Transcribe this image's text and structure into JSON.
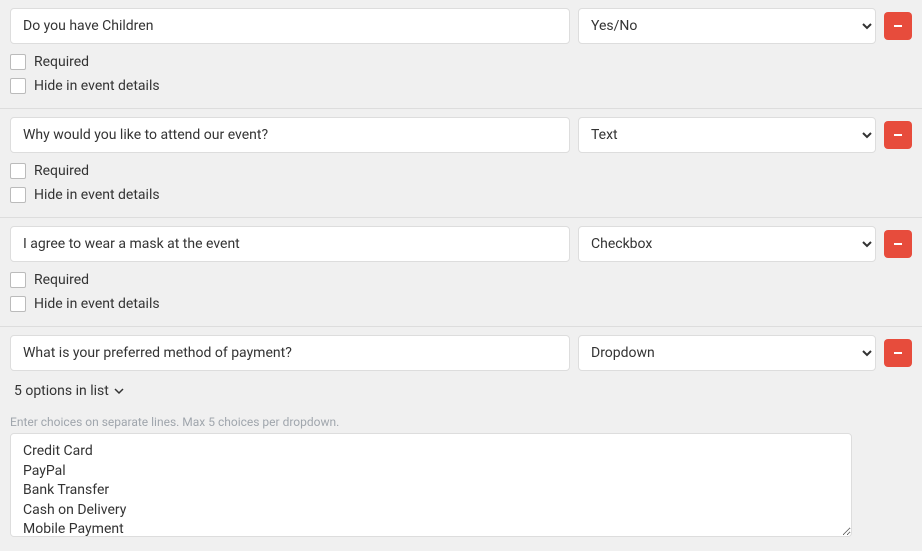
{
  "labels": {
    "required": "Required",
    "hide": "Hide in event details"
  },
  "fields": [
    {
      "question": "Do you have Children",
      "type_options": [
        "Yes/No"
      ],
      "type_selected": "Yes/No",
      "required": false,
      "hide": false
    },
    {
      "question": "Why would you like to attend our event?",
      "type_options": [
        "Text"
      ],
      "type_selected": "Text",
      "required": false,
      "hide": false
    },
    {
      "question": "I agree to wear a mask at the event",
      "type_options": [
        "Checkbox"
      ],
      "type_selected": "Checkbox",
      "required": false,
      "hide": false
    },
    {
      "question": "What is your preferred method of payment?",
      "type_options": [
        "Dropdown"
      ],
      "type_selected": "Dropdown",
      "options_summary": "5 options in list",
      "helper": "Enter choices on separate lines. Max 5 choices per dropdown.",
      "choices": "Credit Card\nPayPal\nBank Transfer\nCash on Delivery\nMobile Payment"
    }
  ]
}
